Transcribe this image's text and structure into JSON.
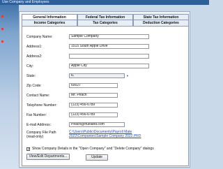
{
  "app": {
    "banner": "Use Company and Employees"
  },
  "tabs_row1": [
    "General Information",
    "Federal Tax Information",
    "State Tax Information"
  ],
  "tabs_row2": [
    "Income Categories",
    "Tax Categories",
    "Deduction Categories"
  ],
  "form": {
    "company_name_label": "Company Name:",
    "company_name_value": "Sample Company",
    "address1_label": "Address1:",
    "address1_value": "1515 South Apple Drive",
    "address2_label": "Address2:",
    "address2_value": "",
    "city_label": "City:",
    "city_value": "Apple City",
    "state_label": "State:",
    "state_value": "IL",
    "zip_label": "Zip Code:",
    "zip_value": "60027",
    "contact_label": "Contact Name:",
    "contact_value": "Mr. Peach",
    "phone_label": "Telephone Number:",
    "phone_value": "(123) 456-6789",
    "fax_label": "Fax Number:",
    "fax_value": "(123) 456-6789",
    "email_label": "E-mail Address:",
    "email_value": "Peach@fruitland.com",
    "filepath_label_1": "Company File Path",
    "filepath_label_2": "(read-only)",
    "filepath_value": "C:\\Users\\Public\\Documents\\Payroll Mate 2022\\Companies\\Sample Company 2022.PRD",
    "show_details_label": "Show Company Details in the \"Open Company\" and \"Delete Company\" dialogs",
    "show_details_checked": "✓",
    "departments_button": "View/Edit Departments...",
    "update_button": "Update"
  }
}
